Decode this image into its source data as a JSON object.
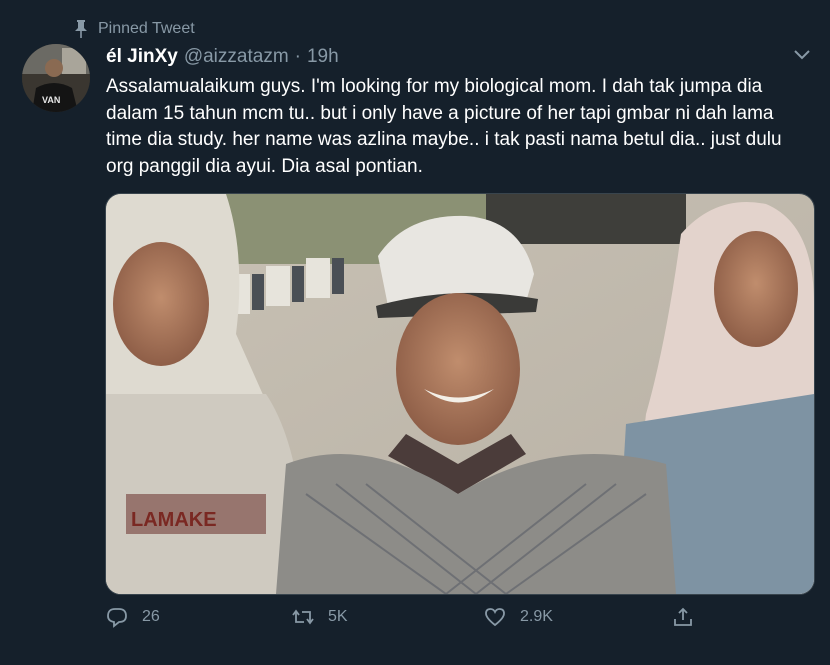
{
  "pinned_label": "Pinned Tweet",
  "author": {
    "display_name": "él JinXy",
    "handle": "@aizzatazm",
    "separator": "·",
    "time": "19h",
    "avatar_text": "VAN"
  },
  "tweet": {
    "text": "Assalamualaikum guys. I'm looking for my biological mom. I dah tak jumpa dia dalam 15 tahun mcm tu.. but i only have a picture of her tapi gmbar ni dah lama time dia study. her name was azlina maybe.. i tak pasti nama betul dia.. just dulu org panggil dia ayui. Dia asal pontian.",
    "shirt_text": "LAMAKE"
  },
  "actions": {
    "reply_count": "26",
    "retweet_count": "5K",
    "like_count": "2.9K"
  },
  "colors": {
    "background": "#15202b",
    "secondary_text": "#8899a6",
    "border": "#38444d"
  },
  "icons": [
    "pin-icon",
    "chevron-down-icon",
    "reply-icon",
    "retweet-icon",
    "like-icon",
    "share-icon"
  ]
}
